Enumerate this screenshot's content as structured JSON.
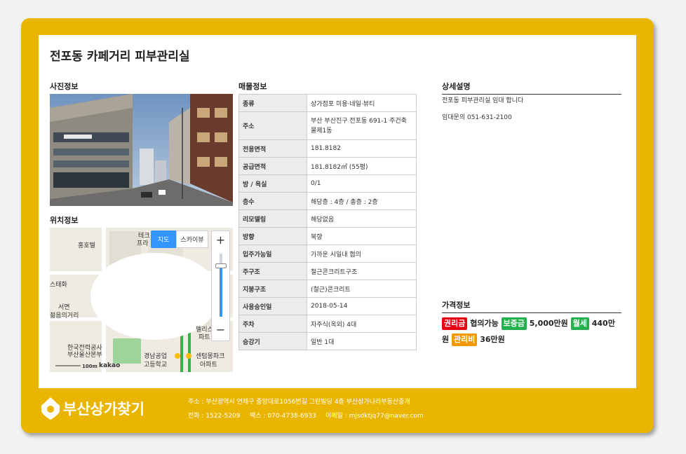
{
  "title": "전포동 카페거리 피부관리실",
  "sections": {
    "photo": "사진정보",
    "location": "위치정보",
    "property": "매물정보",
    "description": "상세설명",
    "price": "가격정보"
  },
  "map": {
    "tab_map": "지도",
    "tab_skyview": "스카이뷰",
    "zoom_in": "+",
    "zoom_out": "−",
    "scale": "100m",
    "brand": "kakao",
    "labels": {
      "l1": "홍호텔",
      "l2": "테크",
      "l3": "프라",
      "l4": "스태화",
      "l5": "서면",
      "l6": "젊음의거리",
      "l7": "한국전력공사",
      "l8": "부산울산본부",
      "l9": "경남공업",
      "l10": "고등학교",
      "l11": "센텀몽파크",
      "l12": "아파트",
      "l13": "펠리스",
      "l14": "파트"
    }
  },
  "property": [
    {
      "key": "종류",
      "value": "상가점포 미용·네일·뷰티"
    },
    {
      "key": "주소",
      "value": "부산 부산진구 전포동 691-1 주건축물제1동"
    },
    {
      "key": "전용면적",
      "value": "181.8182"
    },
    {
      "key": "공급면적",
      "value": "181.8182㎡ (55평)"
    },
    {
      "key": "방 / 욕실",
      "value": "0/1"
    },
    {
      "key": "층수",
      "value": "해당층 : 4층 / 총층 : 2층"
    },
    {
      "key": "리모델링",
      "value": "해당없음"
    },
    {
      "key": "방향",
      "value": "북향"
    },
    {
      "key": "입주가능일",
      "value": "가까운 시일내 협의"
    },
    {
      "key": "주구조",
      "value": "철근콘크리트구조"
    },
    {
      "key": "지붕구조",
      "value": "(철근)콘크리트"
    },
    {
      "key": "사용승인일",
      "value": "2018-05-14"
    },
    {
      "key": "주차",
      "value": "자주식(옥외) 4대"
    },
    {
      "key": "승강기",
      "value": "일반 1대"
    }
  ],
  "description": {
    "line1": "전포동 피부관리실 임대 합니다",
    "line2": "임대문의 051-631-2100"
  },
  "price": {
    "premium_label": "권리금",
    "premium_value": "협의가능",
    "deposit_label": "보증금",
    "deposit_value": "5,000만원",
    "rent_label": "월세",
    "rent_value": "440만원",
    "fee_label": "관리비",
    "fee_value": "36만원"
  },
  "colors": {
    "frame": "#e9b500",
    "premium": "#e60012",
    "deposit": "#22b14c",
    "rent": "#22b14c",
    "fee": "#f39800",
    "map_tab": "#3396ff"
  },
  "footer": {
    "logo_text": "부산상가찾기",
    "address": "주소 : 부산광역시 연제구 중앙대로1056번길 그린빌딩 4층 부산상가나라부동산중개",
    "phone": "전화 : 1522-5209",
    "fax": "팩스 : 070-4738-6933",
    "email": "이메일 : mjsdktjq77@naver.com"
  }
}
